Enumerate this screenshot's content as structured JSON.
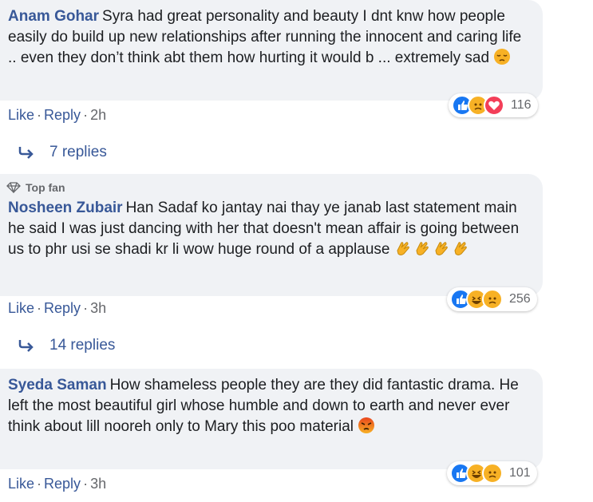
{
  "comments": [
    {
      "author": "Anam Gohar",
      "text": "Syra had great personality and beauty I dnt knw how people easily do build up new relationships after running the innocent and caring life .. even they don’t think abt them how hurting it would b ... extremely sad",
      "emoji": "pensive-face",
      "like": "Like",
      "reply": "Reply",
      "time": "2h",
      "reactions": [
        "like",
        "sad",
        "love"
      ],
      "reaction_count": "116",
      "replies": "7 replies"
    },
    {
      "badge": "Top fan",
      "author": "Nosheen Zubair",
      "text": "Han Sadaf ko jantay nai thay ye janab last statement main he said I was just dancing with her that doesn't mean affair is going between us to phr usi se shadi kr li wow huge round of a applause",
      "emoji": "clapping-hands",
      "like": "Like",
      "reply": "Reply",
      "time": "3h",
      "reactions": [
        "like",
        "haha",
        "sad"
      ],
      "reaction_count": "256",
      "replies": "14 replies"
    },
    {
      "author": "Syeda Saman",
      "text": "How shameless people they are they did fantastic drama. He left the most beautiful girl whose humble and down to earth and never ever think about lill nooreh only to Mary this poo material",
      "emoji": "angry-face",
      "like": "Like",
      "reply": "Reply",
      "time": "3h",
      "reactions": [
        "like",
        "haha",
        "sad"
      ],
      "reaction_count": "101"
    }
  ],
  "separator": "·"
}
